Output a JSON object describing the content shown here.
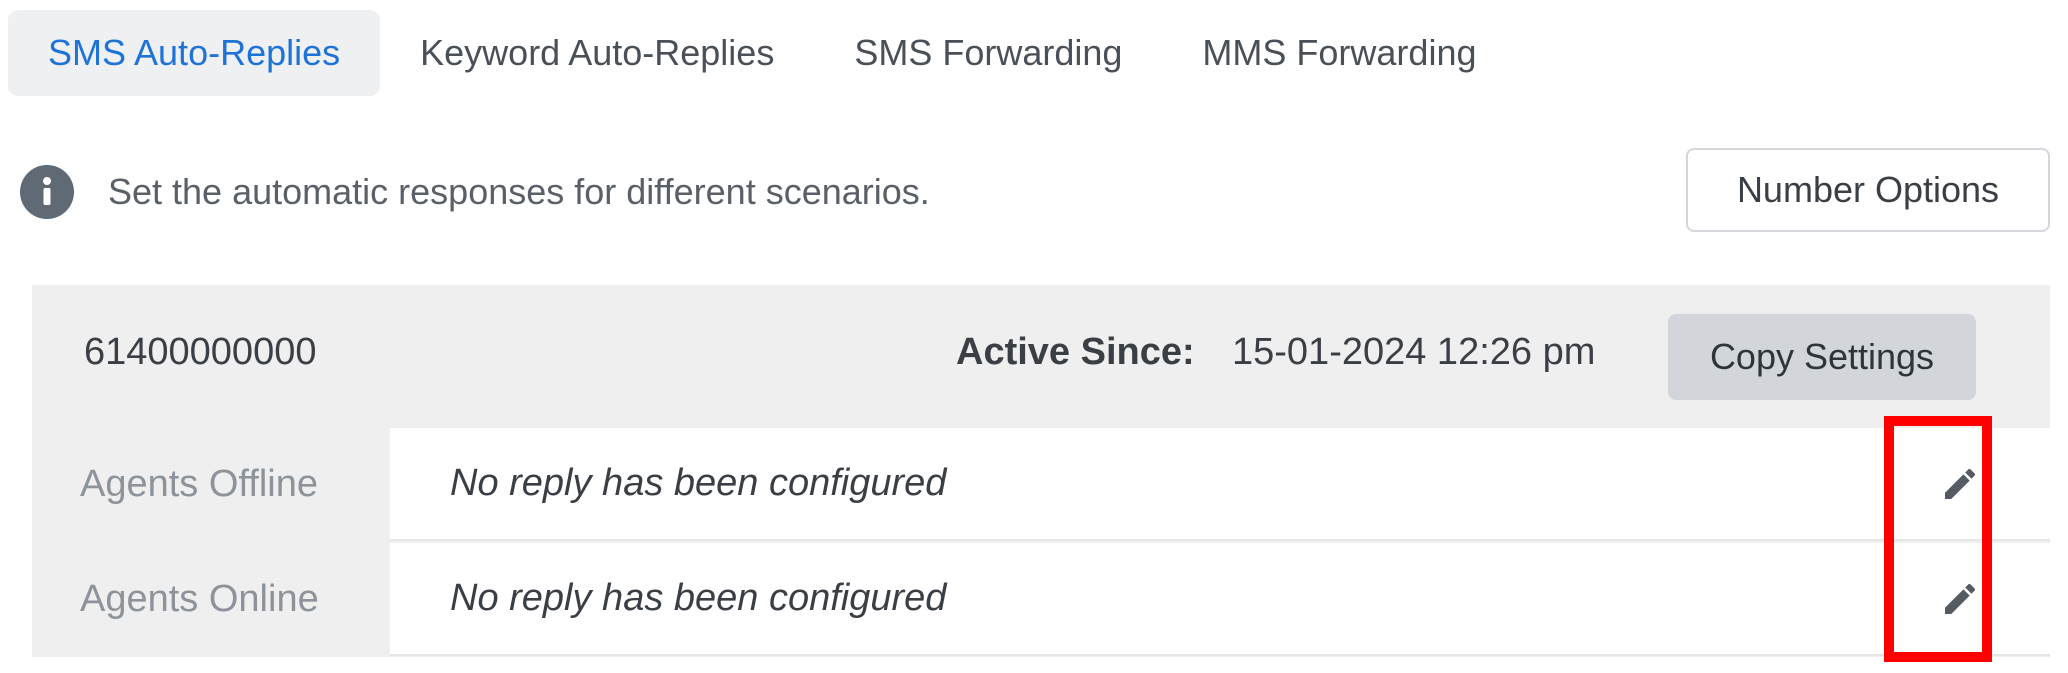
{
  "tabs": [
    {
      "label": "SMS Auto-Replies",
      "active": true
    },
    {
      "label": "Keyword Auto-Replies",
      "active": false
    },
    {
      "label": "SMS Forwarding",
      "active": false
    },
    {
      "label": "MMS Forwarding",
      "active": false
    }
  ],
  "info": {
    "icon": "info-icon",
    "text": "Set the automatic responses for different scenarios."
  },
  "number_options": {
    "label": "Number Options"
  },
  "card": {
    "phone_number": "61400000000",
    "active_since_label": "Active Since:",
    "active_since_value": "15-01-2024 12:26 pm",
    "copy_settings_label": "Copy Settings",
    "rows": [
      {
        "label": "Agents Offline",
        "reply": "No reply has been configured",
        "edit_icon": "pencil-icon"
      },
      {
        "label": "Agents Online",
        "reply": "No reply has been configured",
        "edit_icon": "pencil-icon"
      }
    ]
  },
  "colors": {
    "accent": "#1f73d6",
    "highlight": "#ff0000",
    "card_bg": "#efefef",
    "button_gray": "#d2d6db"
  }
}
